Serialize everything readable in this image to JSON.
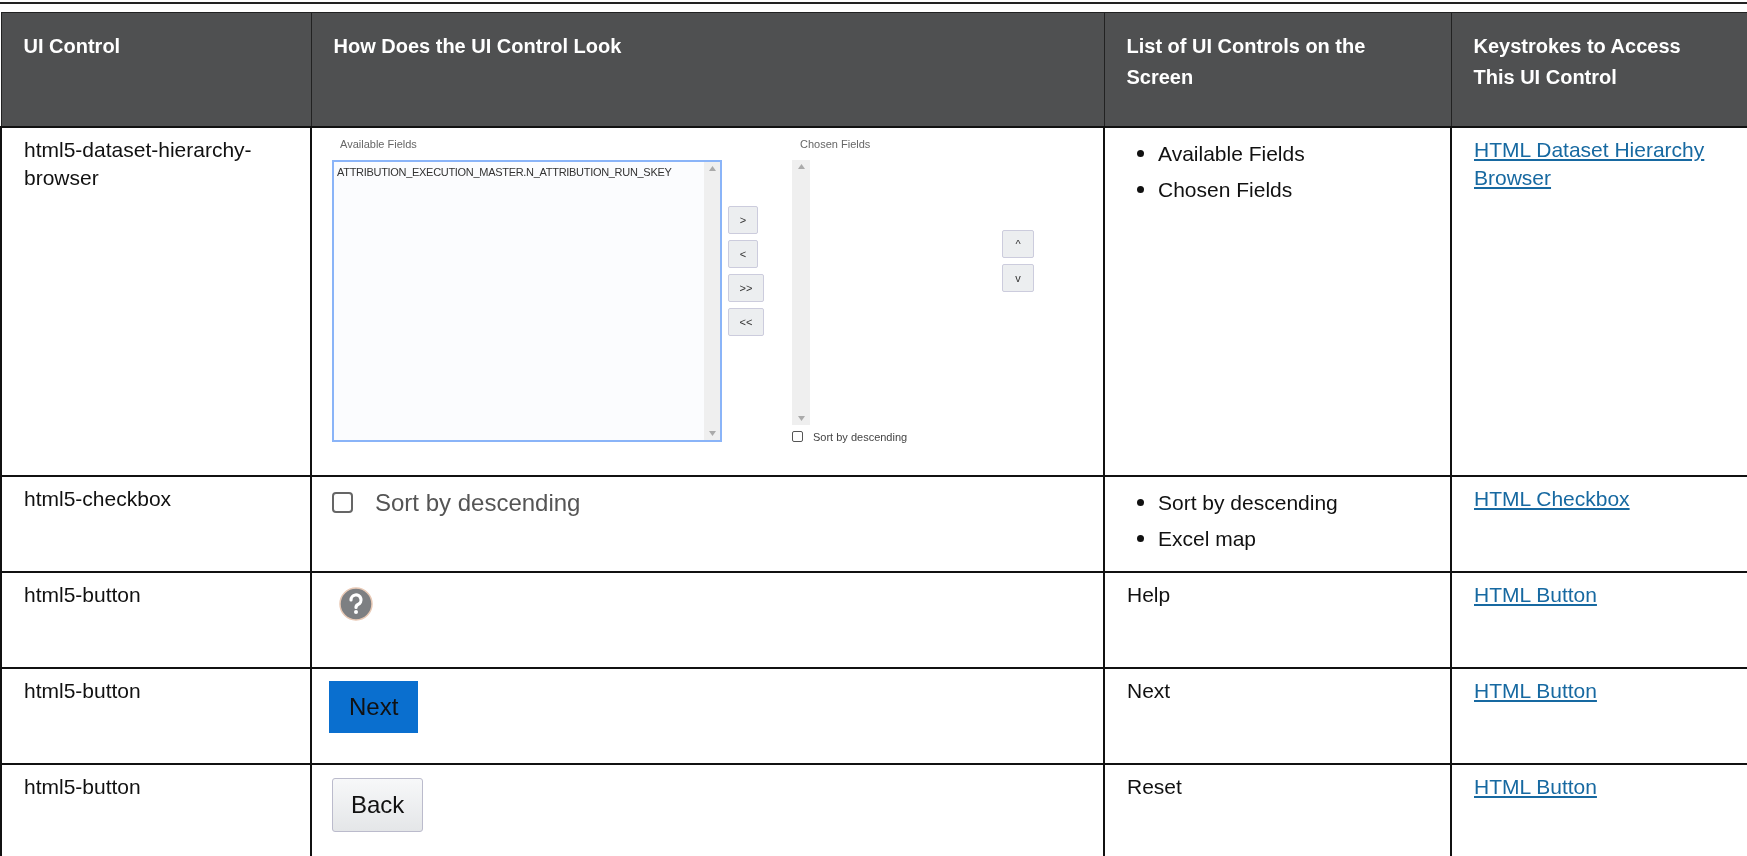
{
  "table": {
    "columns": [
      "UI Control",
      "How Does the UI Control Look",
      "List of UI Controls on the Screen",
      "Keystrokes to Access This UI Control"
    ],
    "rows": [
      {
        "control": "html5-dataset-hierarchy-browser",
        "look": {
          "kind": "dual_list",
          "available_label": "Available Fields",
          "available_items": [
            "ATTRIBUTION_EXECUTION_MASTER.N_ATTRIBUTION_RUN_SKEY"
          ],
          "chosen_label": "Chosen Fields",
          "move_buttons": [
            ">",
            "<",
            ">>",
            "<<"
          ],
          "order_buttons": [
            "^",
            "v"
          ],
          "sort": {
            "label": "Sort by descending",
            "checked": false
          }
        },
        "list": {
          "kind": "bullets",
          "items": [
            "Available Fields",
            "Chosen Fields"
          ]
        },
        "link": "HTML Dataset Hierarchy Browser"
      },
      {
        "control": "html5-checkbox",
        "look": {
          "kind": "checkbox",
          "label": "Sort by descending",
          "checked": false
        },
        "list": {
          "kind": "bullets",
          "items": [
            "Sort by descending",
            "Excel map"
          ]
        },
        "link": "HTML Checkbox"
      },
      {
        "control": "html5-button",
        "look": {
          "kind": "help_icon"
        },
        "list": {
          "kind": "plain",
          "items": [
            "Help"
          ]
        },
        "link": "HTML Button"
      },
      {
        "control": "html5-button",
        "look": {
          "kind": "primary_button",
          "label": "Next"
        },
        "list": {
          "kind": "plain",
          "items": [
            "Next"
          ]
        },
        "link": "HTML Button"
      },
      {
        "control": "html5-button",
        "look": {
          "kind": "secondary_button",
          "label": "Back"
        },
        "list": {
          "kind": "plain",
          "items": [
            "Reset"
          ]
        },
        "link": "HTML Button"
      }
    ]
  }
}
